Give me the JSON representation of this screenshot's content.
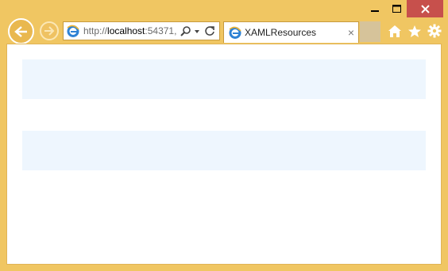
{
  "browser": {
    "address_url_prefix": "http://",
    "address_host": "localhost",
    "address_rest": ":54371,",
    "tab_title": "XAMLResources",
    "tab_close": "×"
  },
  "colors": {
    "frame": "#f0c662",
    "close_button": "#c7504c",
    "content_background": "#ffffff",
    "band": "#eef6fe"
  },
  "icons": [
    "minimize-icon",
    "maximize-icon",
    "close-icon",
    "back-arrow-icon",
    "forward-arrow-icon",
    "ie-logo-icon",
    "search-icon",
    "dropdown-icon",
    "refresh-icon",
    "home-icon",
    "favorites-star-icon",
    "settings-gear-icon"
  ],
  "content": {
    "bands": [
      {},
      {}
    ]
  }
}
